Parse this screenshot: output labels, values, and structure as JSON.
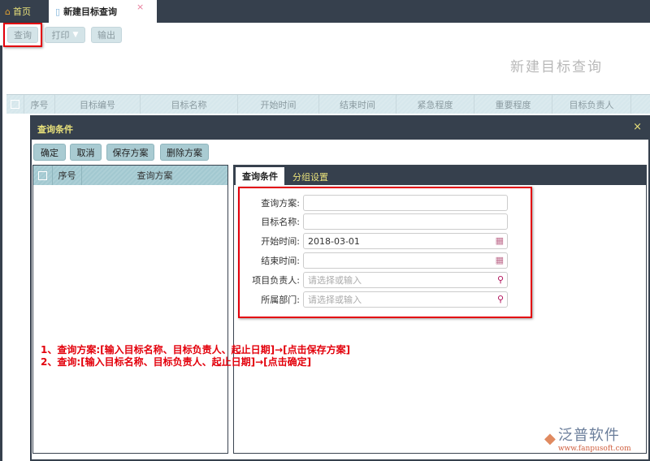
{
  "tabs": {
    "home": "首页",
    "active": "新建目标查询",
    "close": "×"
  },
  "toolbar": {
    "query": "查询",
    "print": "打印",
    "export": "输出"
  },
  "page_title": "新建目标查询",
  "grid": {
    "columns": [
      "序号",
      "目标编号",
      "目标名称",
      "开始时间",
      "结束时间",
      "紧急程度",
      "重要程度",
      "目标负责人"
    ]
  },
  "dialog": {
    "title": "查询条件",
    "close": "×",
    "buttons": [
      "确定",
      "取消",
      "保存方案",
      "删除方案"
    ],
    "scheme_list": {
      "columns": [
        "序号",
        "查询方案"
      ]
    },
    "tabs": [
      "查询条件",
      "分组设置"
    ],
    "fields": [
      {
        "label": "查询方案:",
        "value": "",
        "placeholder": "",
        "icon": ""
      },
      {
        "label": "目标名称:",
        "value": "",
        "placeholder": "",
        "icon": ""
      },
      {
        "label": "开始时间:",
        "value": "2018-03-01",
        "placeholder": "",
        "icon": "calendar-icon"
      },
      {
        "label": "结束时间:",
        "value": "",
        "placeholder": "",
        "icon": "calendar-icon"
      },
      {
        "label": "项目负责人:",
        "value": "",
        "placeholder": "请选择或输入",
        "icon": "search-icon"
      },
      {
        "label": "所属部门:",
        "value": "",
        "placeholder": "请选择或输入",
        "icon": "search-icon"
      }
    ]
  },
  "notes": [
    "1、查询方案:[输入目标名称、目标负责人、起止日期]→[点击保存方案]",
    "2、查询:[输入目标名称、目标负责人、起止日期]→[点击确定]"
  ],
  "logo": {
    "name": "泛普软件",
    "url": "www.fanpusoft.com"
  },
  "colors": {
    "dark": "#36404d",
    "accent": "#e8e07a",
    "highlight": "#e3000b"
  }
}
